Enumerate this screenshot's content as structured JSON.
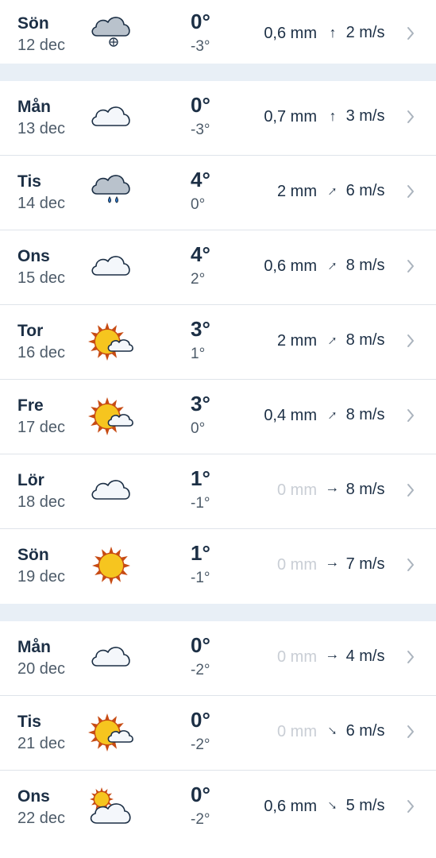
{
  "forecast": {
    "groups": [
      {
        "days": [
          {
            "day": "Sön",
            "date": "12 dec",
            "icon": "cloud-snow-icon",
            "high": "0°",
            "low": "-3°",
            "precip": "0,6 mm",
            "dry": false,
            "wind_arrow": "↑",
            "wind_dir": "north",
            "wind": "2 m/s"
          }
        ]
      },
      {
        "days": [
          {
            "day": "Mån",
            "date": "13 dec",
            "icon": "cloud-icon",
            "high": "0°",
            "low": "-3°",
            "precip": "0,7 mm",
            "dry": false,
            "wind_arrow": "↑",
            "wind_dir": "north",
            "wind": "3 m/s"
          },
          {
            "day": "Tis",
            "date": "14 dec",
            "icon": "cloud-rain-icon",
            "high": "4°",
            "low": "0°",
            "precip": "2 mm",
            "dry": false,
            "wind_arrow": "↑",
            "wind_dir": "north-east",
            "wind": "6 m/s"
          },
          {
            "day": "Ons",
            "date": "15 dec",
            "icon": "cloud-icon",
            "high": "4°",
            "low": "2°",
            "precip": "0,6 mm",
            "dry": false,
            "wind_arrow": "↑",
            "wind_dir": "north-east",
            "wind": "8 m/s"
          },
          {
            "day": "Tor",
            "date": "16 dec",
            "icon": "sun-cloud-icon",
            "high": "3°",
            "low": "1°",
            "precip": "2 mm",
            "dry": false,
            "wind_arrow": "↑",
            "wind_dir": "north-east",
            "wind": "8 m/s"
          },
          {
            "day": "Fre",
            "date": "17 dec",
            "icon": "sun-cloud-icon",
            "high": "3°",
            "low": "0°",
            "precip": "0,4 mm",
            "dry": false,
            "wind_arrow": "↑",
            "wind_dir": "north-east",
            "wind": "8 m/s"
          },
          {
            "day": "Lör",
            "date": "18 dec",
            "icon": "cloud-icon",
            "high": "1°",
            "low": "-1°",
            "precip": "0 mm",
            "dry": true,
            "wind_arrow": "↑",
            "wind_dir": "east",
            "wind": "8 m/s"
          },
          {
            "day": "Sön",
            "date": "19 dec",
            "icon": "sun-icon",
            "high": "1°",
            "low": "-1°",
            "precip": "0 mm",
            "dry": true,
            "wind_arrow": "↑",
            "wind_dir": "east",
            "wind": "7 m/s"
          }
        ]
      },
      {
        "days": [
          {
            "day": "Mån",
            "date": "20 dec",
            "icon": "cloud-icon",
            "high": "0°",
            "low": "-2°",
            "precip": "0 mm",
            "dry": true,
            "wind_arrow": "↑",
            "wind_dir": "east",
            "wind": "4 m/s"
          },
          {
            "day": "Tis",
            "date": "21 dec",
            "icon": "sun-cloud-icon",
            "high": "0°",
            "low": "-2°",
            "precip": "0 mm",
            "dry": true,
            "wind_arrow": "↑",
            "wind_dir": "south-east",
            "wind": "6 m/s"
          },
          {
            "day": "Ons",
            "date": "22 dec",
            "icon": "partly-sunny-icon",
            "high": "0°",
            "low": "-2°",
            "precip": "0,6 mm",
            "dry": false,
            "wind_arrow": "↑",
            "wind_dir": "south-east",
            "wind": "5 m/s"
          }
        ]
      }
    ]
  },
  "colors": {
    "text_primary": "#1c2f45",
    "text_secondary": "#4d5b69",
    "text_dry": "#c9ced5",
    "separator": "#e8eff6",
    "sun": "#f6c51f",
    "sun_rays": "#c74b13"
  }
}
